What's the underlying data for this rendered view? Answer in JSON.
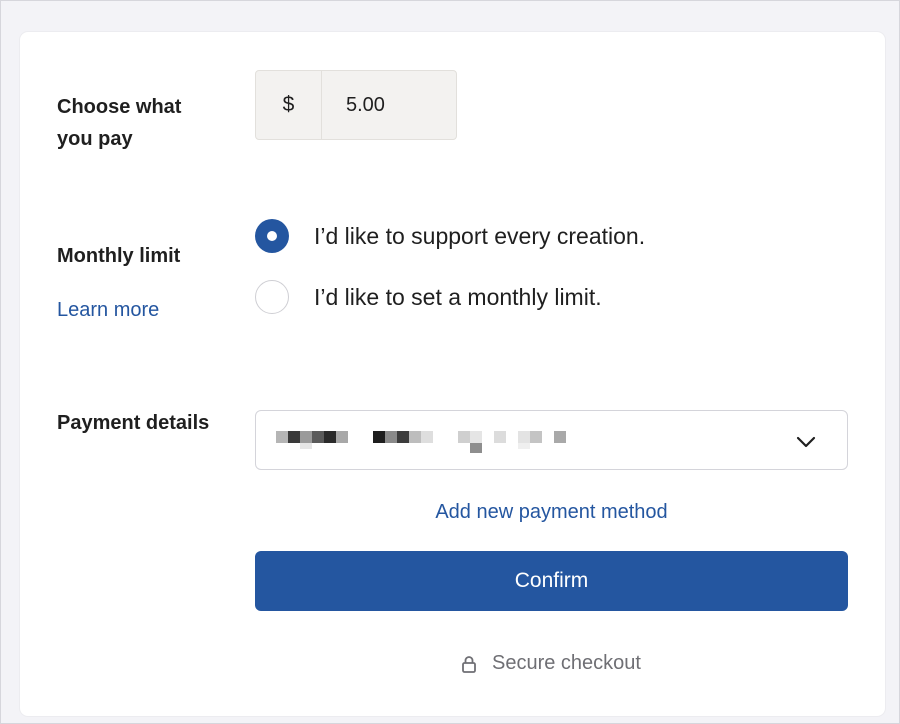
{
  "pricing": {
    "label": "Choose what you pay",
    "currency_symbol": "$",
    "amount": "5.00"
  },
  "monthly_limit": {
    "label": "Monthly limit",
    "learn_more": "Learn more",
    "options": [
      {
        "label": "I’d like to support every creation.",
        "selected": true
      },
      {
        "label": "I’d like to set a monthly limit.",
        "selected": false
      }
    ]
  },
  "payment": {
    "label": "Payment details",
    "selected_method": "",
    "add_method": "Add new payment method",
    "icon": "chevron-down-icon"
  },
  "actions": {
    "confirm": "Confirm",
    "secure_checkout": "Secure checkout",
    "secure_icon": "lock-icon"
  },
  "colors": {
    "accent": "#2456a0",
    "muted_text": "#6f6f74",
    "input_bg": "#f3f2f0"
  }
}
